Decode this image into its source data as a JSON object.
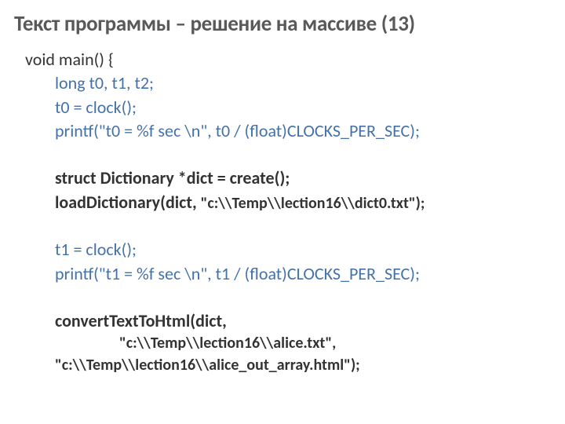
{
  "title": "Текст программы – решение на массиве (13)",
  "code": {
    "l1": "void main() {",
    "l2": "long t0, t1, t2;",
    "l3": "t0 = clock();",
    "l4": "printf(\"t0 = %f sec \\n\", t0 / (float)CLOCKS_PER_SEC);",
    "l5": "struct Dictionary *dict = create();",
    "l6a": "loadDictionary(dict, ",
    "l6b": "\"c:\\\\Temp\\\\lection16\\\\dict0.txt\");",
    "l7": "t1 = clock();",
    "l8": "printf(\"t1 = %f sec \\n\", t1 / (float)CLOCKS_PER_SEC);",
    "l9": "convertTextToHtml(dict,",
    "l10": "\"c:\\\\Temp\\\\lection16\\\\alice.txt\",",
    "l11": "\"c:\\\\Temp\\\\lection16\\\\alice_out_array.html\");"
  }
}
